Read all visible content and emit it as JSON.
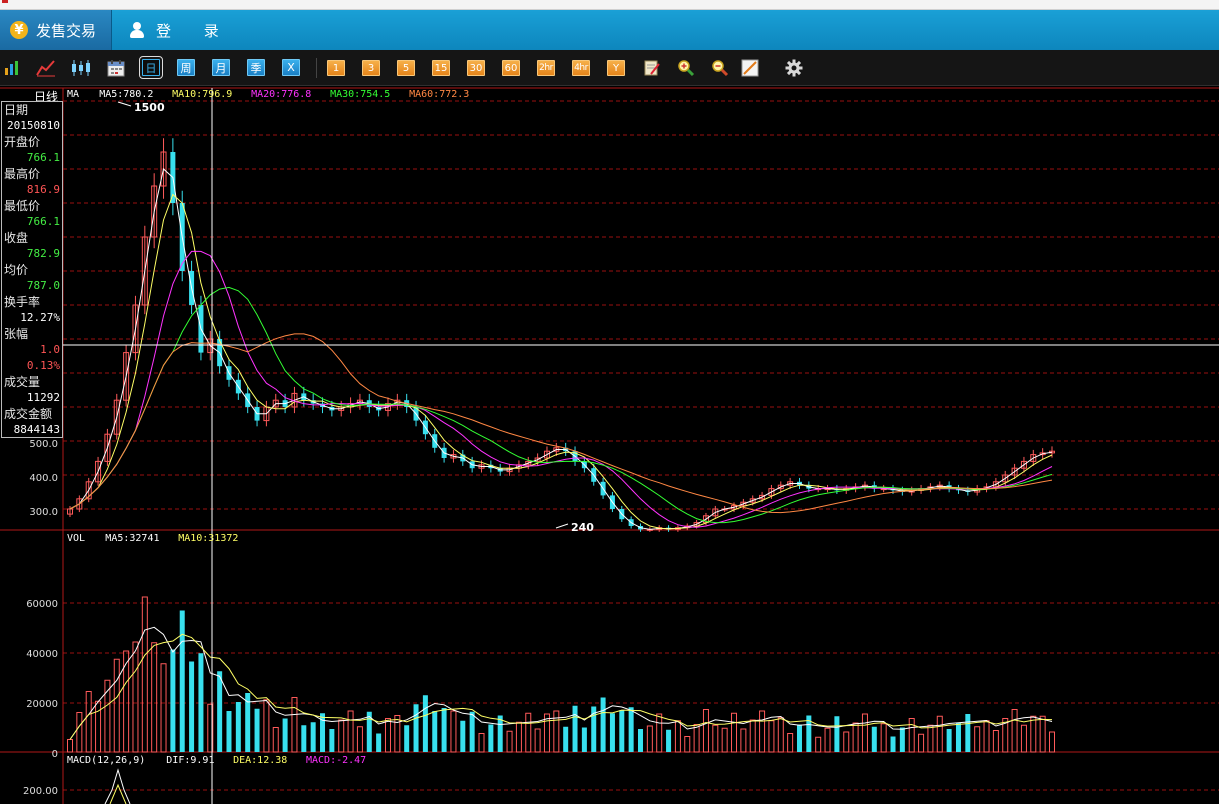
{
  "header": {
    "trade_tab": "发售交易",
    "trade_icon": "yen-icon",
    "login_tab": "登 录",
    "login_icon": "user-icon"
  },
  "toolbar": {
    "chart_type_icons": [
      "bar-chart-icon",
      "line-chart-icon",
      "candlestick-icon",
      "calendar-icon"
    ],
    "period_buttons": [
      "日",
      "周",
      "月",
      "季",
      "X"
    ],
    "period_selected": "日",
    "minute_buttons": [
      "1",
      "3",
      "5",
      "15",
      "30",
      "60",
      "2hr",
      "4hr",
      "Y"
    ],
    "tool_icons": [
      "edit-icon",
      "zoom-in-icon",
      "zoom-out-icon",
      "draw-line-icon"
    ],
    "settings_icon": "gear-icon"
  },
  "info_panel": {
    "period": "日线",
    "fields": [
      {
        "label": "日期",
        "value": "20150810",
        "color": "#ffffff"
      },
      {
        "label": "开盘价",
        "value": "766.1",
        "color": "#44ee44"
      },
      {
        "label": "最高价",
        "value": "816.9",
        "color": "#ff5555"
      },
      {
        "label": "最低价",
        "value": "766.1",
        "color": "#44ee44"
      },
      {
        "label": "收盘",
        "value": "782.9",
        "color": "#44ee44"
      },
      {
        "label": "均价",
        "value": "787.0",
        "color": "#44ee44"
      },
      {
        "label": "换手率",
        "value": "12.27%",
        "color": "#ffffff"
      },
      {
        "label": "张幅",
        "value": "1.0",
        "color": "#ff5555"
      },
      {
        "label": "",
        "value": "0.13%",
        "color": "#ff5555"
      },
      {
        "label": "成交量",
        "value": "11292",
        "color": "#ffffff"
      },
      {
        "label": "成交金额",
        "value": "8844143",
        "color": "#ffffff"
      }
    ]
  },
  "price_panel": {
    "legend": [
      {
        "text": "MA",
        "color": "#ffffff"
      },
      {
        "text": "MA5:780.2",
        "color": "#ffffff"
      },
      {
        "text": "MA10:796.9",
        "color": "#ffff66"
      },
      {
        "text": "MA20:776.8",
        "color": "#ff33ff"
      },
      {
        "text": "MA30:754.5",
        "color": "#33ff33"
      },
      {
        "text": "MA60:772.3",
        "color": "#ff8844"
      }
    ],
    "y_ticks": [
      "500.0",
      "400.0",
      "300.0"
    ],
    "high_label": "1500",
    "low_label": "240"
  },
  "volume_panel": {
    "legend": [
      {
        "text": "VOL",
        "color": "#ffffff"
      },
      {
        "text": "MA5:32741",
        "color": "#ffffff"
      },
      {
        "text": "MA10:31372",
        "color": "#ffff66"
      }
    ],
    "y_ticks": [
      "60000",
      "40000",
      "20000",
      "0"
    ]
  },
  "macd_panel": {
    "legend": [
      {
        "text": "MACD(12,26,9)",
        "color": "#ffffff"
      },
      {
        "text": "DIF:9.91",
        "color": "#ffffff"
      },
      {
        "text": "DEA:12.38",
        "color": "#ffff66"
      },
      {
        "text": "MACD:-2.47",
        "color": "#ff33ff"
      }
    ],
    "y_ticks": [
      "200.00"
    ]
  },
  "chart_data": {
    "type": "candlestick",
    "price": {
      "closes": [
        300,
        330,
        380,
        440,
        520,
        620,
        760,
        900,
        1100,
        1250,
        1350,
        1200,
        1000,
        900,
        760,
        800,
        720,
        680,
        640,
        600,
        560,
        600,
        620,
        600,
        640,
        620,
        610,
        600,
        590,
        600,
        610,
        620,
        600,
        590,
        610,
        620,
        600,
        560,
        520,
        480,
        450,
        460,
        440,
        420,
        430,
        420,
        410,
        420,
        430,
        440,
        450,
        470,
        480,
        470,
        440,
        420,
        380,
        340,
        300,
        270,
        250,
        240,
        240,
        245,
        240,
        245,
        250,
        260,
        280,
        300,
        300,
        310,
        320,
        330,
        340,
        360,
        370,
        380,
        370,
        360,
        360,
        360,
        355,
        360,
        365,
        370,
        360,
        360,
        355,
        350,
        355,
        360,
        365,
        370,
        360,
        355,
        350,
        360,
        365,
        380,
        400,
        420,
        440,
        460,
        465,
        470
      ],
      "y_ticks": [
        500,
        400,
        300
      ],
      "high": 1500,
      "low": 240
    },
    "volume": {
      "y_ticks": [
        60000,
        40000,
        20000,
        0
      ]
    },
    "macd": {
      "y_ticks": [
        200
      ]
    }
  }
}
